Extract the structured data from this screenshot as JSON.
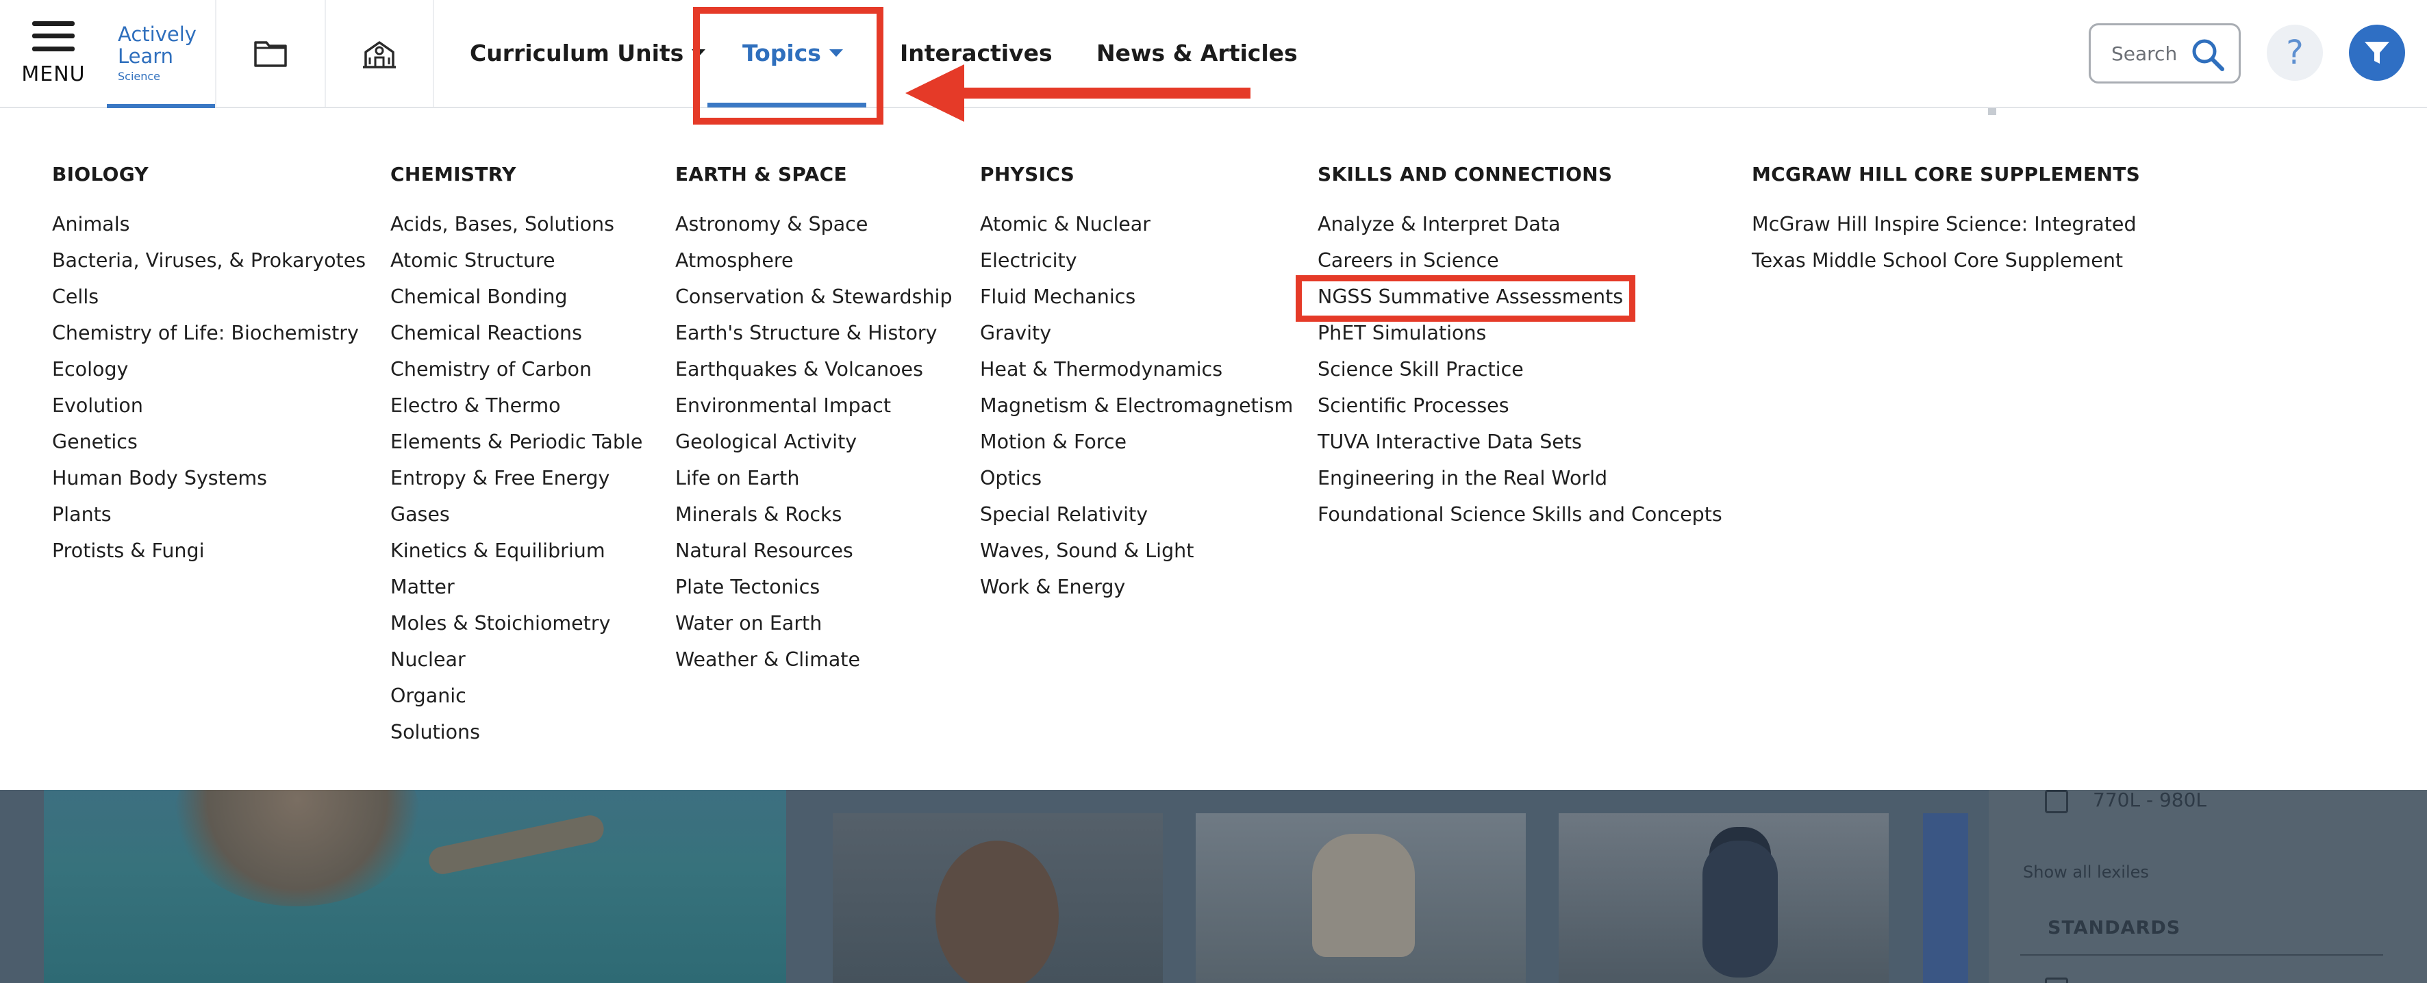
{
  "header": {
    "menu_label": "MENU",
    "logo_line1": "Actively",
    "logo_line2": "Learn",
    "logo_subtitle": "Science",
    "folder_icon": "folder-icon",
    "school_icon": "school-icon",
    "nav": {
      "curriculum_units": "Curriculum Units",
      "topics": "Topics",
      "interactives": "Interactives",
      "news_articles": "News & Articles"
    },
    "search_placeholder": "Search",
    "help_label": "?"
  },
  "colors": {
    "brand_blue": "#2f6fbd",
    "annotation_red": "#e53a28"
  },
  "topics_menu": {
    "columns": [
      {
        "heading": "BIOLOGY",
        "items": [
          "Animals",
          "Bacteria, Viruses, & Prokaryotes",
          "Cells",
          "Chemistry of Life: Biochemistry",
          "Ecology",
          "Evolution",
          "Genetics",
          "Human Body Systems",
          "Plants",
          "Protists & Fungi"
        ]
      },
      {
        "heading": "CHEMISTRY",
        "items": [
          "Acids, Bases, Solutions",
          "Atomic Structure",
          "Chemical Bonding",
          "Chemical Reactions",
          "Chemistry of Carbon",
          "Electro & Thermo",
          "Elements & Periodic Table",
          "Entropy & Free Energy",
          "Gases",
          "Kinetics & Equilibrium",
          "Matter",
          "Moles & Stoichiometry",
          "Nuclear",
          "Organic",
          "Solutions"
        ]
      },
      {
        "heading": "EARTH & SPACE",
        "items": [
          "Astronomy & Space",
          "Atmosphere",
          "Conservation & Stewardship",
          "Earth's Structure & History",
          "Earthquakes & Volcanoes",
          "Environmental Impact",
          "Geological Activity",
          "Life on Earth",
          "Minerals & Rocks",
          "Natural Resources",
          "Plate Tectonics",
          "Water on Earth",
          "Weather & Climate"
        ]
      },
      {
        "heading": "PHYSICS",
        "items": [
          "Atomic & Nuclear",
          "Electricity",
          "Fluid Mechanics",
          "Gravity",
          "Heat & Thermodynamics",
          "Magnetism & Electromagnetism",
          "Motion & Force",
          "Optics",
          "Special Relativity",
          "Waves, Sound & Light",
          "Work & Energy"
        ]
      },
      {
        "heading": "SKILLS AND CONNECTIONS",
        "items": [
          "Analyze & Interpret Data",
          "Careers in Science",
          "NGSS Summative Assessments",
          "PhET Simulations",
          "Science Skill Practice",
          "Scientific Processes",
          "TUVA Interactive Data Sets",
          "Engineering in the Real World",
          "Foundational Science Skills and Concepts"
        ]
      },
      {
        "heading": "MCGRAW HILL CORE SUPPLEMENTS",
        "items": [
          "McGraw Hill Inspire Science: Integrated",
          "Texas Middle School Core Supplement"
        ]
      }
    ]
  },
  "background_page": {
    "lexile_option": "770L - 980L",
    "show_all_lexiles": "Show all lexiles",
    "standards_heading": "STANDARDS"
  }
}
